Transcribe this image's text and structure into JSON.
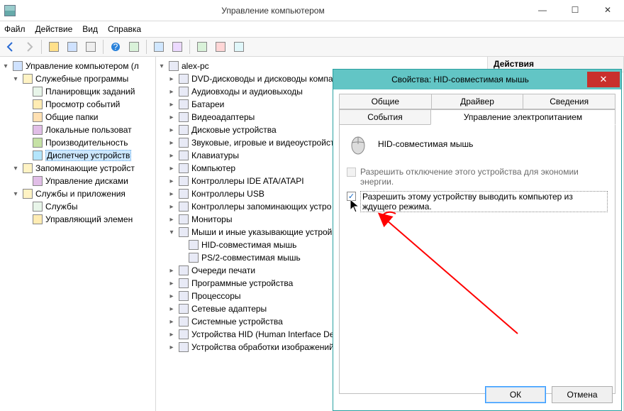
{
  "window": {
    "title": "Управление компьютером",
    "menus": {
      "file": "Файл",
      "action": "Действие",
      "view": "Вид",
      "help": "Справка"
    }
  },
  "left_tree": {
    "root": "Управление компьютером (л",
    "groups": [
      {
        "label": "Служебные программы",
        "items": [
          "Планировщик заданий",
          "Просмотр событий",
          "Общие папки",
          "Локальные пользоват",
          "Производительность",
          "Диспетчер устройств"
        ]
      },
      {
        "label": "Запоминающие устройст",
        "items": [
          "Управление дисками"
        ]
      },
      {
        "label": "Службы и приложения",
        "items": [
          "Службы",
          "Управляющий элемен"
        ]
      }
    ]
  },
  "mid_tree": {
    "root": "alex-pc",
    "items": [
      "DVD-дисководы и дисководы компа",
      "Аудиовходы и аудиовыходы",
      "Батареи",
      "Видеоадаптеры",
      "Дисковые устройства",
      "Звуковые, игровые и видеоустройст",
      "Клавиатуры",
      "Компьютер",
      "Контроллеры IDE ATA/ATAPI",
      "Контроллеры USB",
      "Контроллеры запоминающих устро",
      "Мониторы"
    ],
    "mice_label": "Мыши и иные указывающие устрой",
    "mice_children": [
      "HID-совместимая мышь",
      "PS/2-совместимая мышь"
    ],
    "rest": [
      "Очереди печати",
      "Программные устройства",
      "Процессоры",
      "Сетевые адаптеры",
      "Системные устройства",
      "Устройства HID (Human Interface Dev",
      "Устройства обработки изображений"
    ]
  },
  "right_pane": {
    "header": "Действия"
  },
  "dialog": {
    "title": "Свойства: HID-совместимая мышь",
    "tabs": {
      "general": "Общие",
      "driver": "Драйвер",
      "details": "Сведения",
      "events": "События",
      "power": "Управление электропитанием"
    },
    "device_name": "HID-совместимая мышь",
    "checkbox_allow_off": "Разрешить отключение этого устройства для экономии энергии.",
    "checkbox_wake": "Разрешить этому устройству выводить компьютер из ждущего режима.",
    "ok": "ОК",
    "cancel": "Отмена"
  }
}
